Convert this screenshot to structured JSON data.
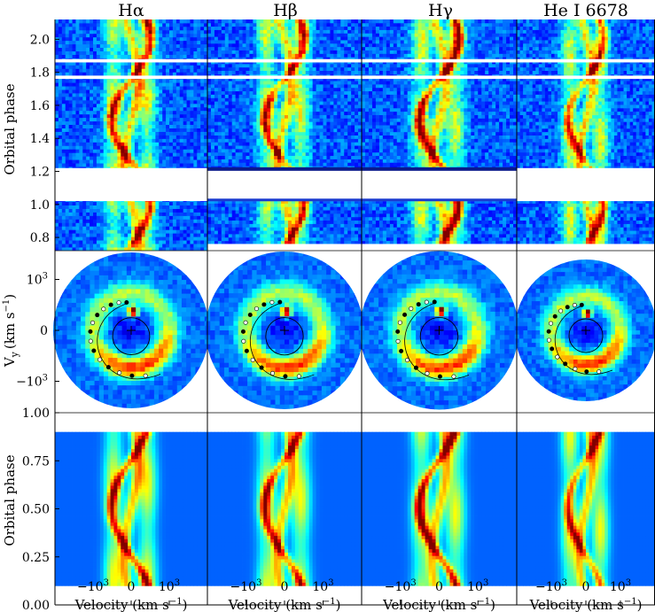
{
  "chart_data": {
    "type": "heatmap",
    "panel_titles": [
      "Hα",
      "Hβ",
      "Hγ",
      "He I 6678"
    ],
    "trailed_spectra": {
      "ylabel": "Orbital phase",
      "yticks": [
        "0.8",
        "1.0",
        "1.2",
        "1.4",
        "1.6",
        "1.8",
        "2.0"
      ],
      "ylim": [
        0.72,
        2.12
      ],
      "gaps": [
        [
          1.22,
          1.02
        ],
        [
          1.78,
          1.76
        ],
        [
          1.88,
          1.86
        ]
      ]
    },
    "doppler_maps": {
      "ylabel": "V",
      "ylabel_sub": "y",
      "ylabel_units": "(km s",
      "ylabel_sup": "−1",
      "ylabel_close": ")",
      "yticks": [
        "10",
        "0",
        "−10"
      ],
      "yticks_sup": [
        "3",
        "",
        "3"
      ],
      "ylim": [
        -1600,
        1600
      ],
      "colormap": "jet"
    },
    "model_spectra": {
      "ylabel": "Orbital phase",
      "yticks": [
        "0.00",
        "0.25",
        "0.50",
        "0.75",
        "1.00"
      ],
      "ylim": [
        0,
        1
      ]
    },
    "xaxis": {
      "label": "Velocity (km s",
      "label_sup": "−1",
      "label_close": ")",
      "ticks": [
        "−10",
        "0",
        "10"
      ],
      "ticks_sup": [
        "3",
        "",
        "3"
      ],
      "xlim": [
        -2000,
        2000
      ]
    }
  }
}
